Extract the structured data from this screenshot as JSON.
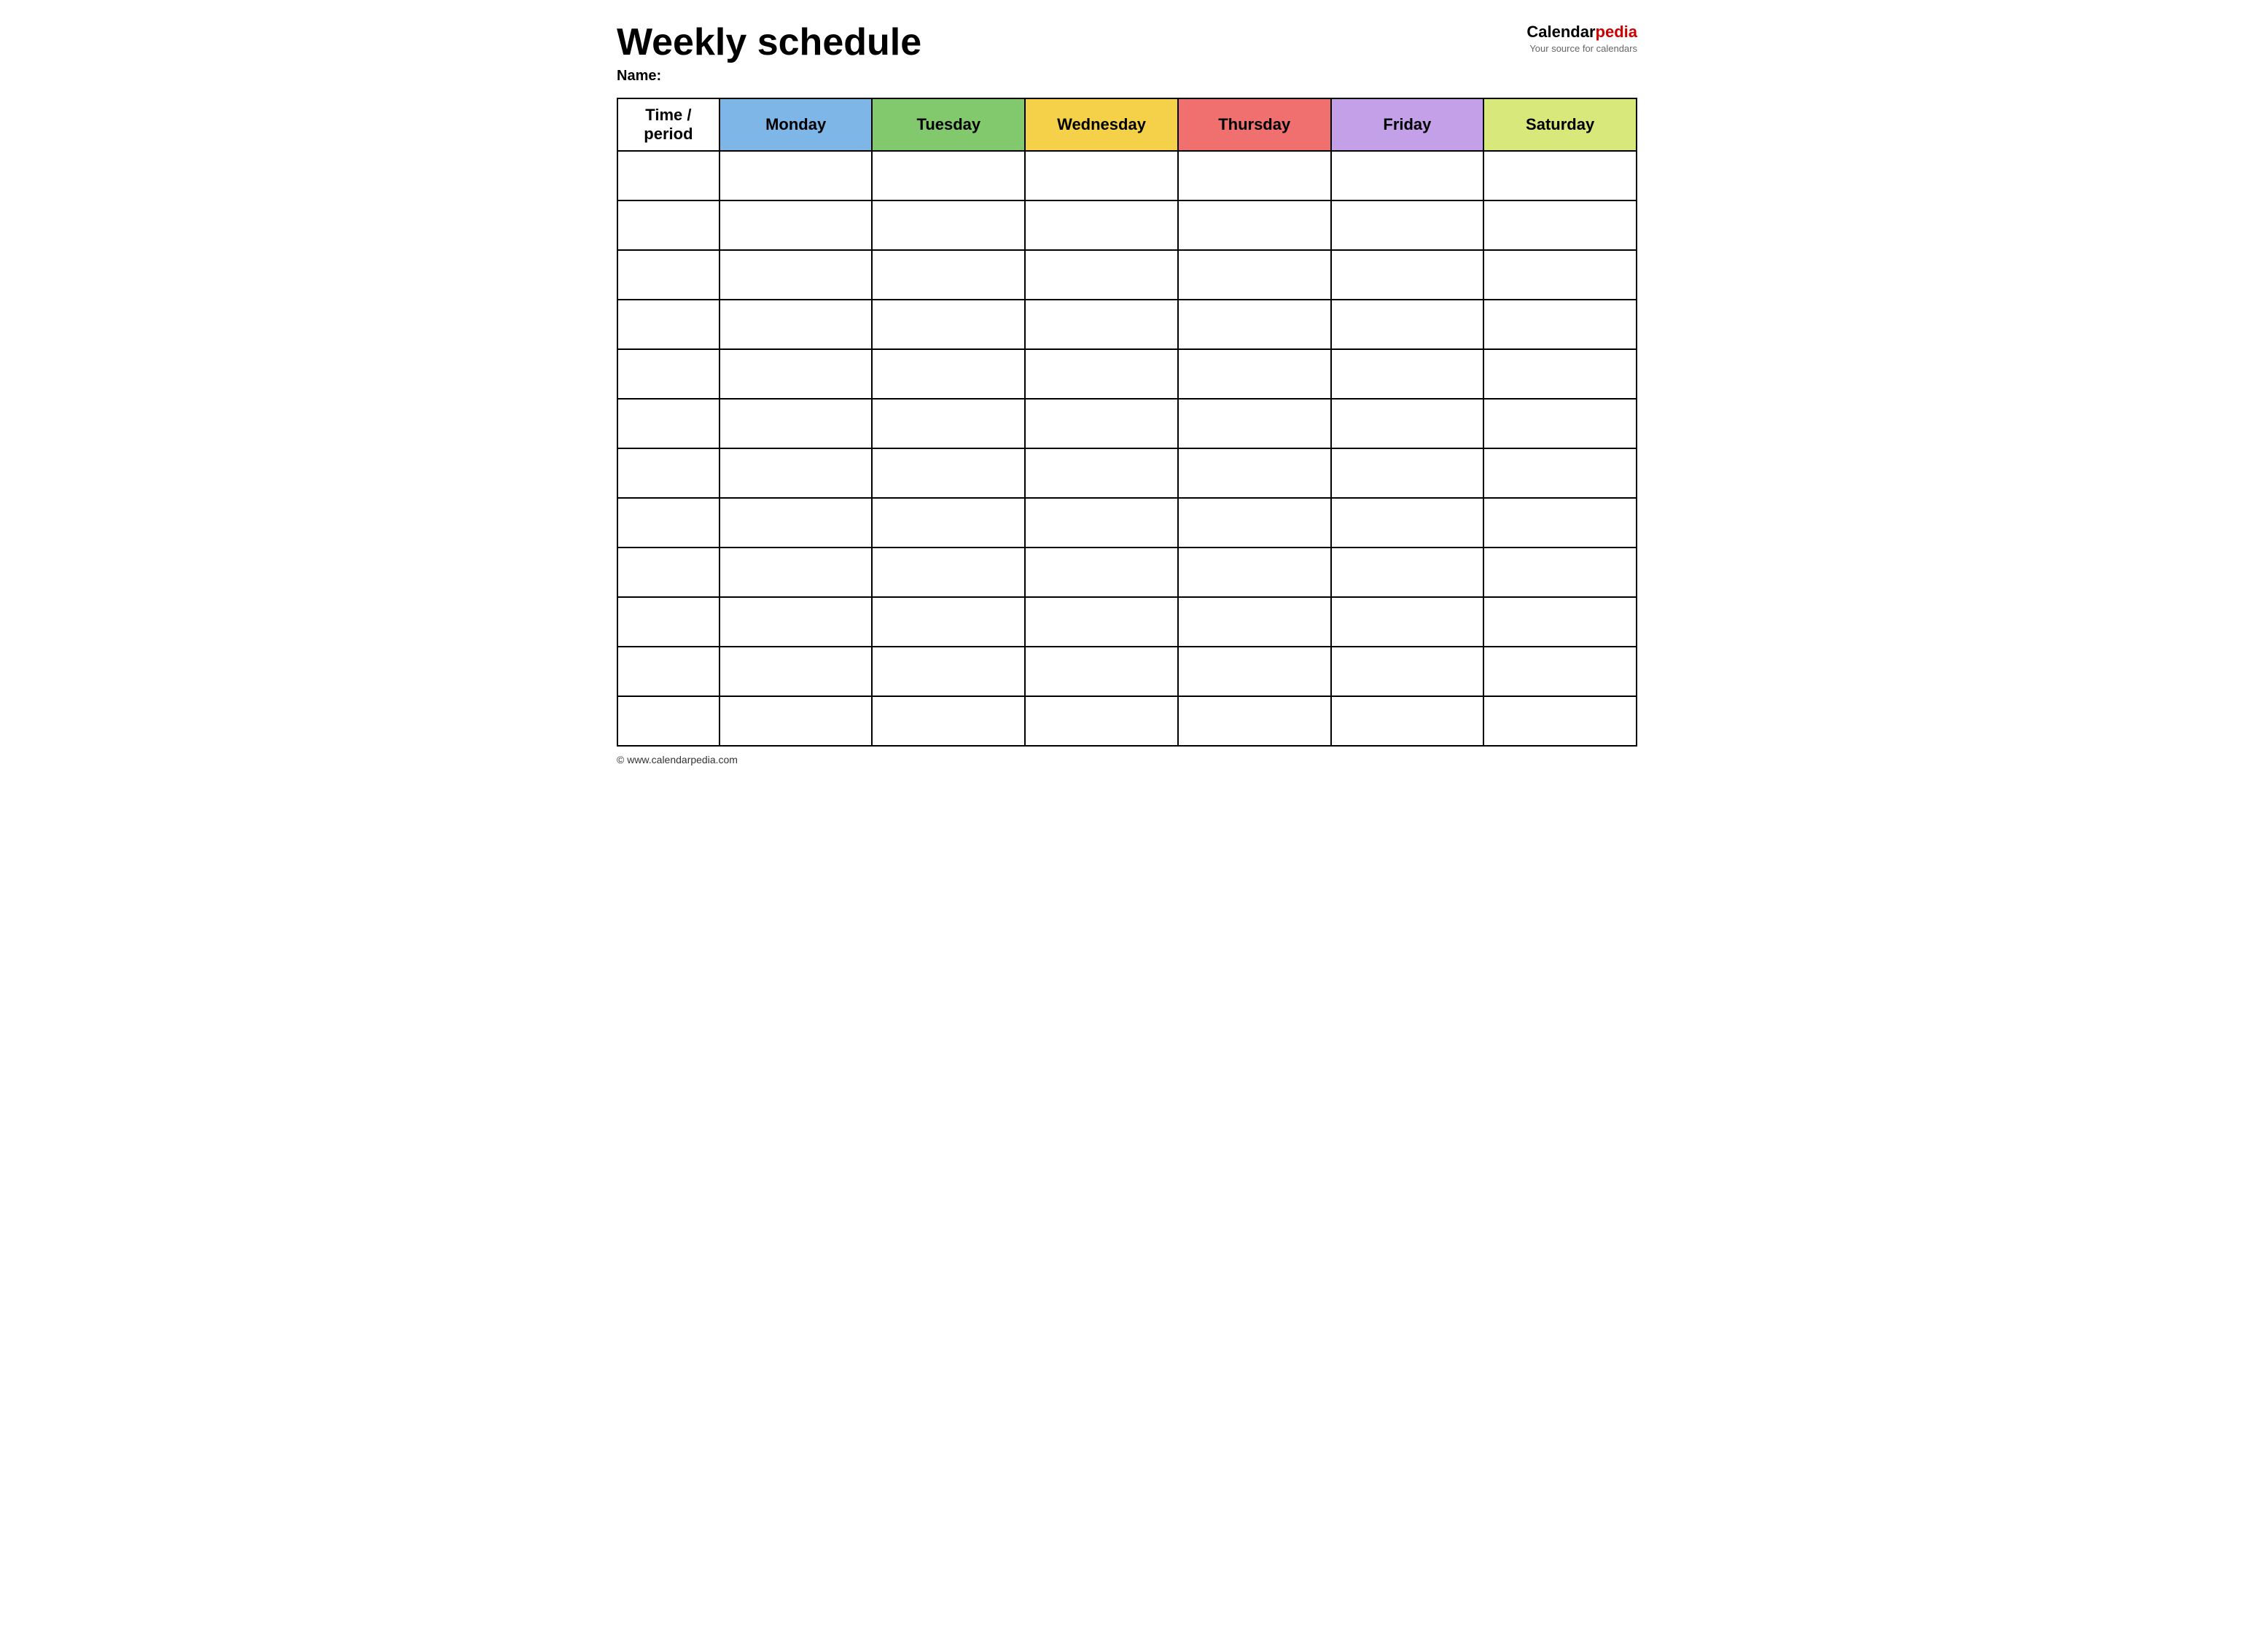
{
  "header": {
    "title": "Weekly schedule",
    "name_label": "Name:",
    "logo": {
      "text_part1": "Calendar",
      "text_part2": "pedia",
      "tagline": "Your source for calendars"
    }
  },
  "table": {
    "columns": [
      {
        "key": "time",
        "label": "Time / period",
        "color": "#ffffff"
      },
      {
        "key": "monday",
        "label": "Monday",
        "color": "#7EB6E8"
      },
      {
        "key": "tuesday",
        "label": "Tuesday",
        "color": "#82C96E"
      },
      {
        "key": "wednesday",
        "label": "Wednesday",
        "color": "#F5D14A"
      },
      {
        "key": "thursday",
        "label": "Thursday",
        "color": "#F07070"
      },
      {
        "key": "friday",
        "label": "Friday",
        "color": "#C4A0E8"
      },
      {
        "key": "saturday",
        "label": "Saturday",
        "color": "#D8E87A"
      }
    ],
    "row_count": 12
  },
  "footer": {
    "url": "© www.calendarpedia.com"
  }
}
